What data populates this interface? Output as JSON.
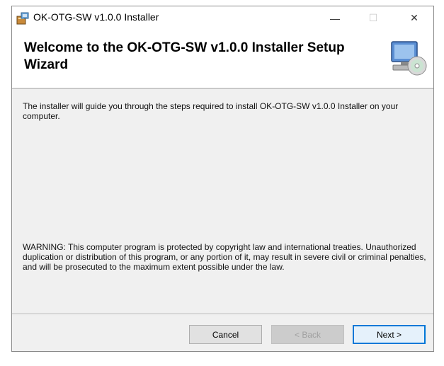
{
  "window": {
    "title": "OK-OTG-SW v1.0.0 Installer",
    "controls": {
      "minimize": "—",
      "maximize": "☐",
      "close": "✕"
    }
  },
  "header": {
    "title": "Welcome to the OK-OTG-SW v1.0.0 Installer Setup Wizard",
    "icon": "computer-cd-icon"
  },
  "body": {
    "intro": "The installer will guide you through the steps required to install OK-OTG-SW v1.0.0 Installer on your computer.",
    "warning": "WARNING: This computer program is protected by copyright law and international treaties. Unauthorized duplication or distribution of this program, or any portion of it, may result in severe civil or criminal penalties, and will be prosecuted to the maximum extent possible under the law."
  },
  "buttons": {
    "cancel": "Cancel",
    "back": "< Back",
    "next": "Next >"
  },
  "colors": {
    "focus_border": "#0078d7",
    "dialog_bg": "#f0f0f0"
  }
}
